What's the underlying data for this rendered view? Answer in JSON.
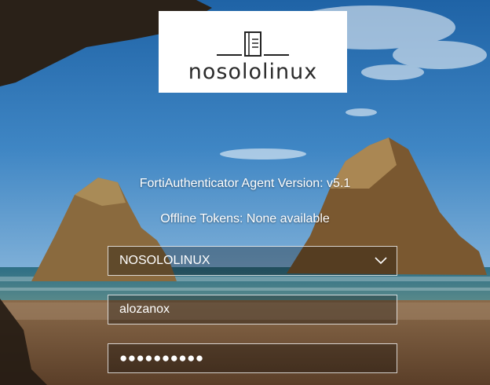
{
  "brand": {
    "logo_text": "nosololinux"
  },
  "info": {
    "version_text": "FortiAuthenticator Agent Version: v5.1",
    "offline_tokens_text": "Offline Tokens: None available"
  },
  "form": {
    "domain_value": "NOSOLOLINUX",
    "username_value": "alozanox",
    "password_masked": "●●●●●●●●●●"
  },
  "colors": {
    "field_border": "#d8d8d8",
    "text": "#ffffff",
    "logo_bg": "#ffffff"
  }
}
